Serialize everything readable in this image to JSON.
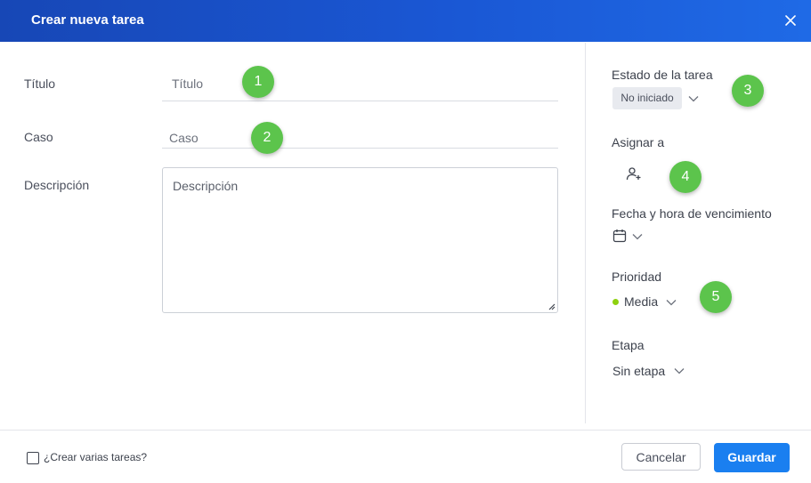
{
  "dialog": {
    "title": "Crear nueva tarea"
  },
  "form": {
    "title_label": "Título",
    "title_placeholder": "Título",
    "case_label": "Caso",
    "case_placeholder": "Caso",
    "description_label": "Descripción",
    "description_placeholder": "Descripción"
  },
  "side": {
    "status_label": "Estado de la tarea",
    "status_value": "No iniciado",
    "assign_label": "Asignar a",
    "due_label": "Fecha y hora de vencimiento",
    "priority_label": "Prioridad",
    "priority_value": "Media",
    "priority_color": "#8ed10f",
    "stage_label": "Etapa",
    "stage_value": "Sin etapa"
  },
  "badges": [
    "1",
    "2",
    "3",
    "4",
    "5"
  ],
  "footer": {
    "multi_label": "¿Crear varias tareas?",
    "cancel_label": "Cancelar",
    "save_label": "Guardar"
  },
  "colors": {
    "header": "#1a57d4",
    "primary": "#1a7ff0",
    "badge": "#5cc44c"
  }
}
